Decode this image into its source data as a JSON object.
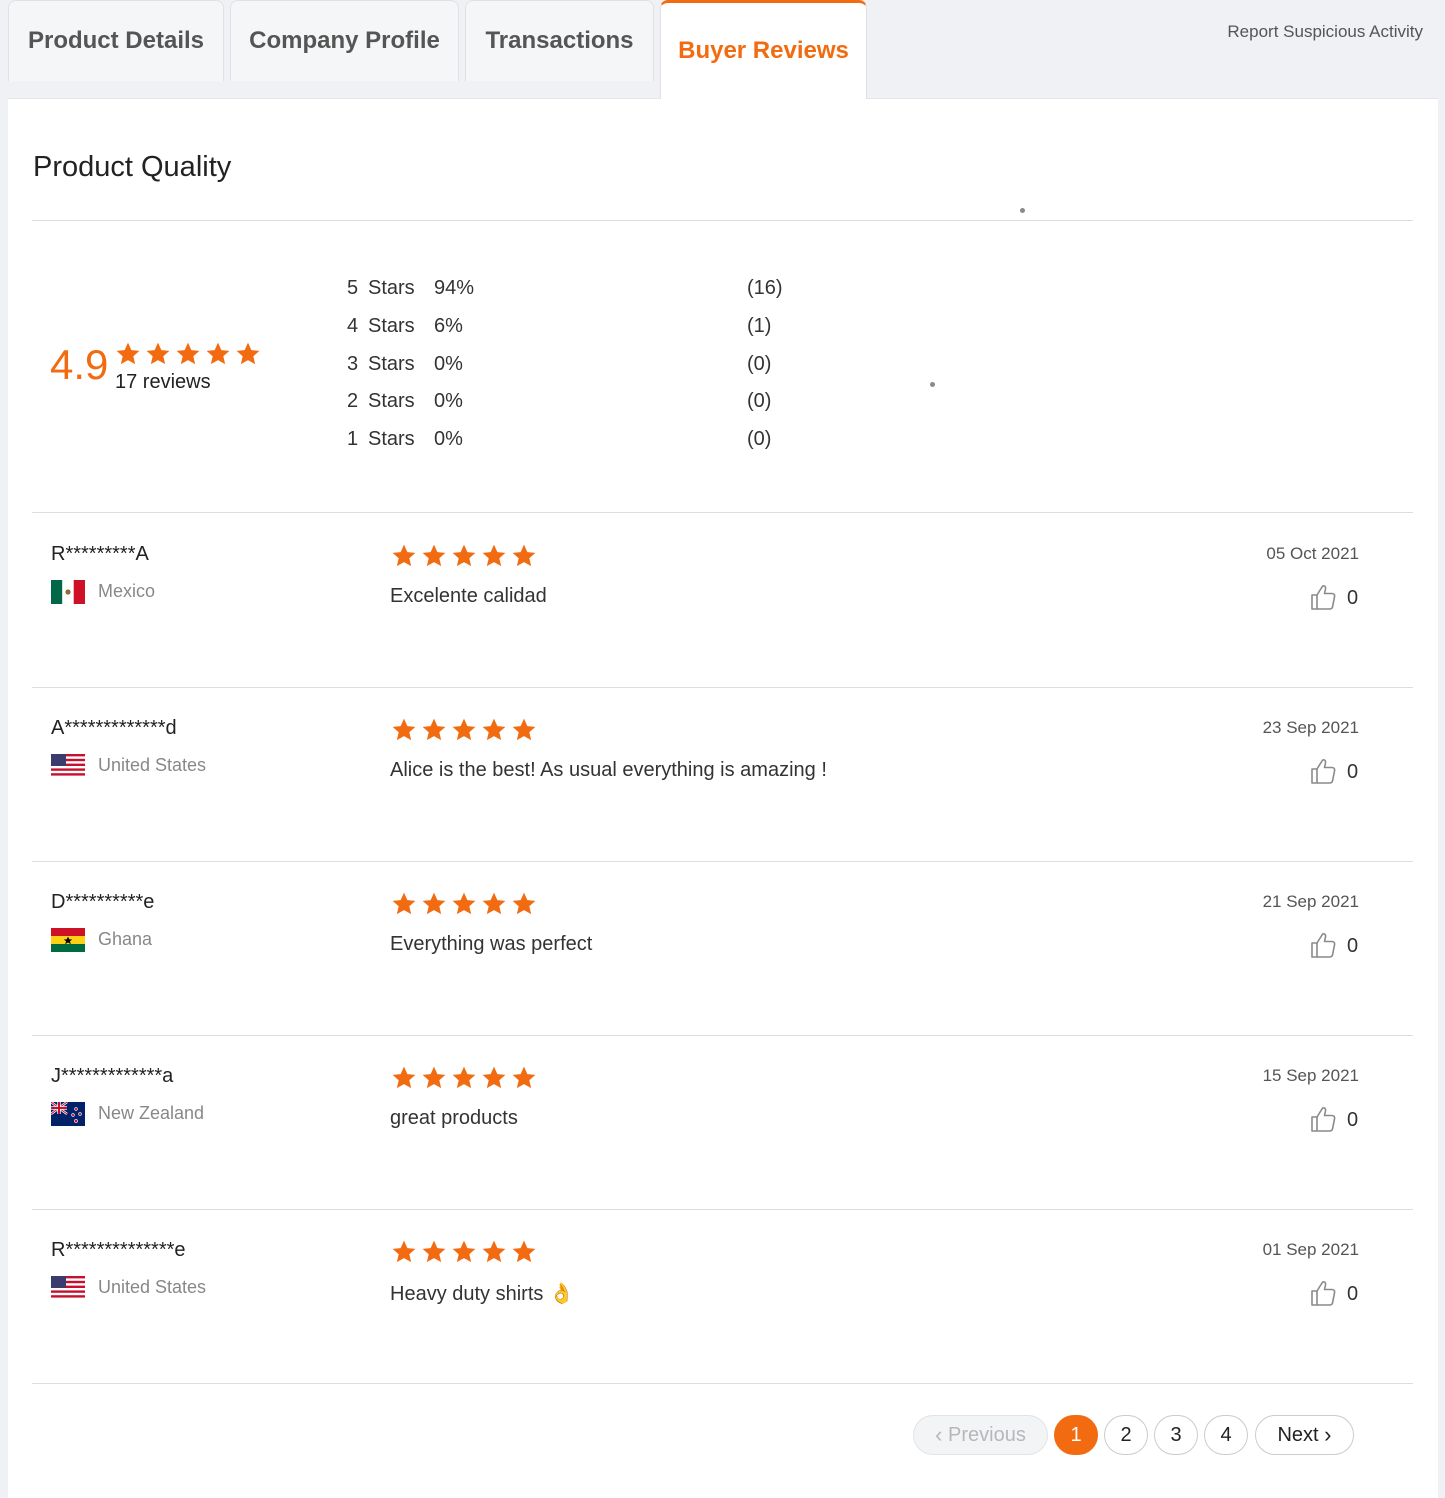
{
  "tabs": [
    {
      "label": "Product Details",
      "active": false
    },
    {
      "label": "Company Profile",
      "active": false
    },
    {
      "label": "Transactions",
      "active": false
    },
    {
      "label": "Buyer Reviews",
      "active": true
    }
  ],
  "report_link": "Report Suspicious Activity",
  "section_title": "Product Quality",
  "summary": {
    "score": "4.9",
    "stars": 5,
    "review_count": "17 reviews",
    "distribution": [
      {
        "num": "5",
        "label": "Stars",
        "percent": "94%",
        "count": "(16)"
      },
      {
        "num": "4",
        "label": "Stars",
        "percent": "6%",
        "count": "(1)"
      },
      {
        "num": "3",
        "label": "Stars",
        "percent": "0%",
        "count": "(0)"
      },
      {
        "num": "2",
        "label": "Stars",
        "percent": "0%",
        "count": "(0)"
      },
      {
        "num": "1",
        "label": "Stars",
        "percent": "0%",
        "count": "(0)"
      }
    ]
  },
  "reviews": [
    {
      "name": "R*********A",
      "country": "Mexico",
      "flag": "mexico-flag-icon",
      "rating": 5,
      "text": "Excelente calidad",
      "date": "05 Oct 2021",
      "likes": "0"
    },
    {
      "name": "A*************d",
      "country": "United States",
      "flag": "usa-flag-icon",
      "rating": 5,
      "text": "Alice is the best! As usual everything is amazing !",
      "date": "23 Sep 2021",
      "likes": "0"
    },
    {
      "name": "D**********e",
      "country": "Ghana",
      "flag": "ghana-flag-icon",
      "rating": 5,
      "text": "Everything was perfect",
      "date": "21 Sep 2021",
      "likes": "0"
    },
    {
      "name": "J*************a",
      "country": "New Zealand",
      "flag": "new-zealand-flag-icon",
      "rating": 5,
      "text": "great products",
      "date": "15 Sep 2021",
      "likes": "0"
    },
    {
      "name": "R**************e",
      "country": "United States",
      "flag": "usa-flag-icon",
      "rating": 5,
      "text": "Heavy duty shirts 👌",
      "date": "01 Sep 2021",
      "likes": "0"
    }
  ],
  "pagination": {
    "previous": "Previous",
    "next": "Next",
    "pages": [
      "1",
      "2",
      "3",
      "4"
    ],
    "current": "1"
  },
  "colors": {
    "accent": "#f26b10",
    "star": "#f26b10",
    "muted": "#888888"
  }
}
